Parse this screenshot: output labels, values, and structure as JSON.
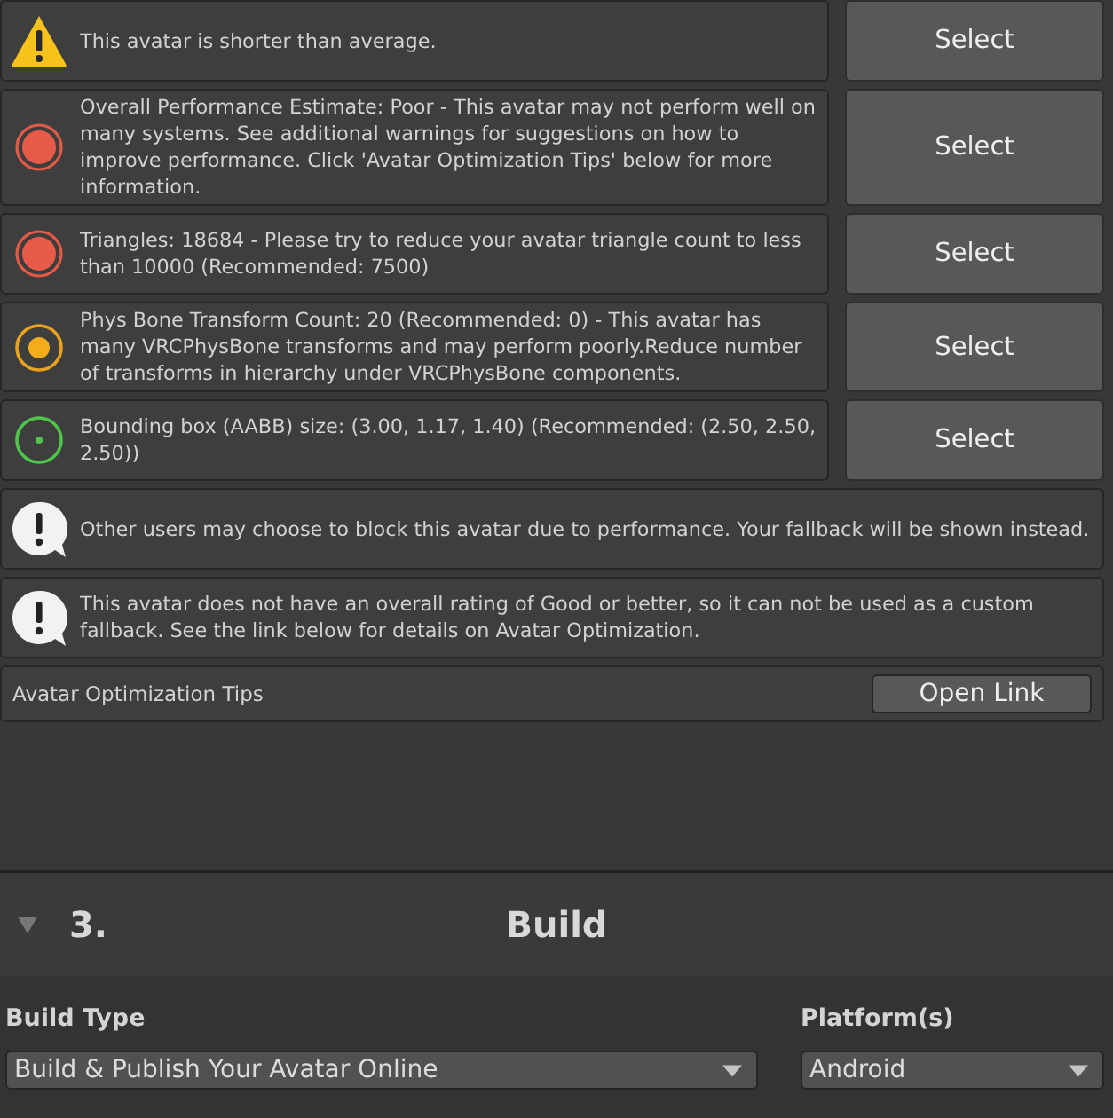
{
  "messages": [
    {
      "kind": "warning",
      "text": "This avatar is shorter than average.",
      "button": "Select"
    },
    {
      "kind": "error",
      "text": "Overall Performance Estimate: Poor - This avatar may not perform well on many systems. See additional warnings for suggestions on how to improve performance. Click 'Avatar Optimization Tips' below for more information.",
      "button": "Select"
    },
    {
      "kind": "error",
      "text": "Triangles: 18684 - Please try to reduce your avatar triangle count to less than 10000 (Recommended: 7500)",
      "button": "Select"
    },
    {
      "kind": "medium",
      "text": "Phys Bone Transform Count: 20 (Recommended: 0) - This avatar has many VRCPhysBone transforms and may perform poorly.Reduce number of transforms in hierarchy under VRCPhysBone components.",
      "button": "Select"
    },
    {
      "kind": "good",
      "text": "Bounding box (AABB) size: (3.00, 1.17, 1.40) (Recommended: (2.50, 2.50, 2.50))",
      "button": "Select"
    },
    {
      "kind": "notice",
      "text": "Other users may choose to block this avatar due to performance. Your fallback will be shown instead."
    },
    {
      "kind": "notice",
      "text": "This avatar does not have an overall rating of Good or better, so it can not be used as a custom fallback. See the link below for details on Avatar Optimization."
    }
  ],
  "tips": {
    "label": "Avatar Optimization Tips",
    "button": "Open Link"
  },
  "build": {
    "expanded": true,
    "number": "3.",
    "title": "Build",
    "build_type": {
      "label": "Build Type",
      "value": "Build & Publish Your Avatar Online"
    },
    "platform": {
      "label": "Platform(s)",
      "value": "Android"
    }
  }
}
